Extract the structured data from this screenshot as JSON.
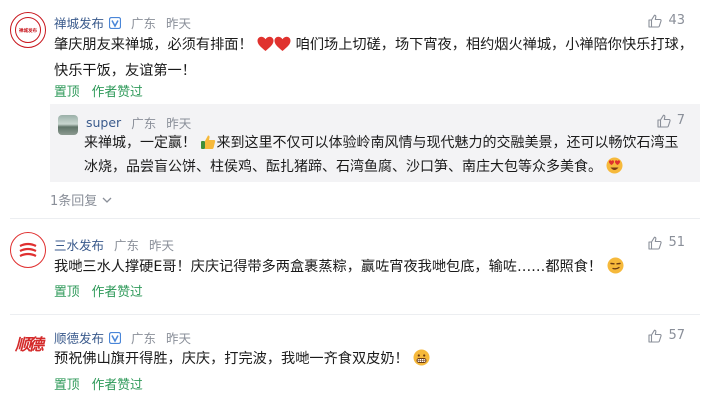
{
  "comments": [
    {
      "author": "禅城发布",
      "location": "广东",
      "time": "昨天",
      "likes": "43",
      "text_before": "肇庆朋友来禅城，必须有排面！",
      "text_after": "咱们场上切磋，场下宵夜，相约烟火禅城，小禅陪你快乐打球，快乐干饭，友谊第一！",
      "avatar_text": "禅城发布",
      "actions": [
        "置顶",
        "作者赞过"
      ],
      "reply": {
        "author": "super",
        "location": "广东",
        "time": "昨天",
        "likes": "7",
        "text_before": "来禅城，一定赢！",
        "text_after": "来到这里不仅可以体验岭南风情与现代魅力的交融美景，还可以畅饮石湾玉冰烧，品尝盲公饼、柱侯鸡、酝扎猪蹄、石湾鱼腐、沙口笋、南庄大包等众多美食。"
      },
      "more_replies": "1条回复"
    },
    {
      "author": "三水发布",
      "location": "广东",
      "time": "昨天",
      "likes": "51",
      "text": "我哋三水人撑硬E哥！庆庆记得带多两盒裹蒸粽，赢咗宵夜我哋包底，输咗……都照食！",
      "actions": [
        "置顶",
        "作者赞过"
      ]
    },
    {
      "author": "顺德发布",
      "location": "广东",
      "time": "昨天",
      "likes": "57",
      "text": "预祝佛山旗开得胜，庆庆，打完波，我哋一齐食双皮奶！",
      "avatar_text": "顺德",
      "actions": [
        "置顶",
        "作者赞过"
      ]
    }
  ],
  "colors": {
    "author": "#3a5a8c",
    "meta": "#8a8f99",
    "action": "#2f9a5a",
    "reply_bg": "#f3f3f5",
    "brand_red": "#c8161d"
  },
  "icons": [
    "thumb-up-icon",
    "verified-badge-icon",
    "heart-emoji-icon",
    "thumbs-up-emoji-icon",
    "heart-eyes-emoji-icon",
    "smirk-emoji-icon",
    "grin-emoji-icon",
    "chevron-down-icon"
  ]
}
